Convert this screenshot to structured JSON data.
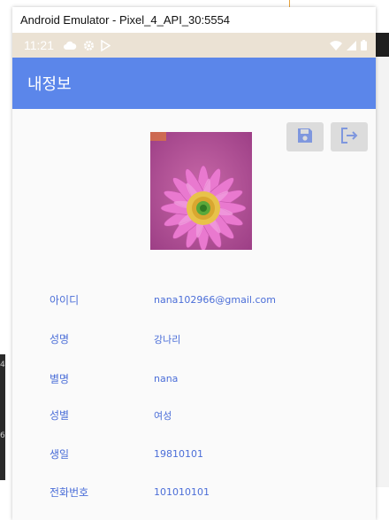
{
  "window": {
    "title": "Android Emulator - Pixel_4_API_30:5554"
  },
  "status_bar": {
    "time": "11:21",
    "icons": [
      "cloud-icon",
      "gear-icon",
      "play-store-icon",
      "wifi-icon",
      "signal-icon",
      "battery-icon"
    ]
  },
  "app_bar": {
    "title": "내정보"
  },
  "actions": {
    "save_icon": "save-icon",
    "logout_icon": "logout-icon"
  },
  "profile": {
    "photo": "pink-gerbera-flower-photo",
    "fields": [
      {
        "label": "아이디",
        "value": "nana102966@gmail.com"
      },
      {
        "label": "성명",
        "value": "강나리"
      },
      {
        "label": "별명",
        "value": "nana"
      },
      {
        "label": "성별",
        "value": "여성"
      },
      {
        "label": "생일",
        "value": "19810101"
      },
      {
        "label": "전화번호",
        "value": "101010101"
      }
    ]
  },
  "colors": {
    "app_bar": "#5b86ea",
    "text_accent": "#4b6ed8",
    "status_bar": "#ebe2d4",
    "button": "#dcdcdc"
  }
}
